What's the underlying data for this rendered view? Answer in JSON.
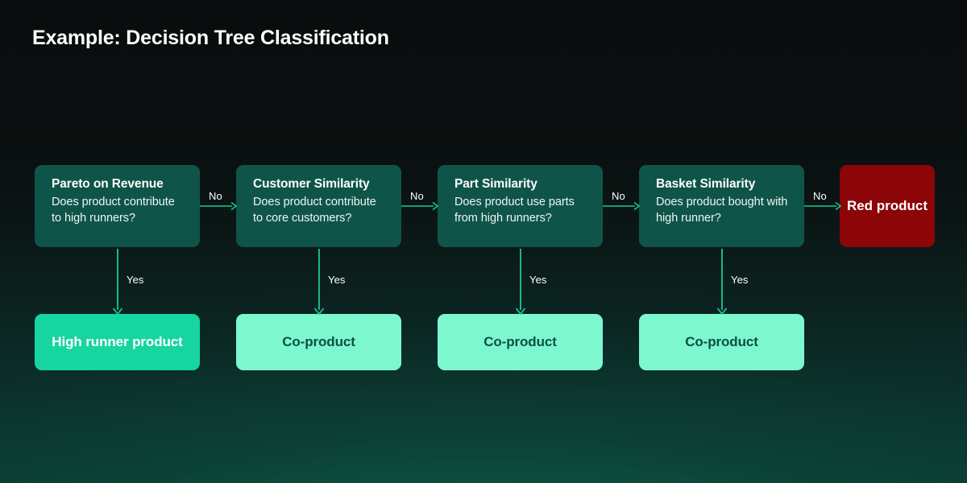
{
  "header": {
    "title": "Example: Decision Tree Classification"
  },
  "colors": {
    "background_top": "#0a0d0d",
    "background_bottom": "#0a3a32",
    "decision_box": "#0f5449",
    "high_runner_box": "#17d5a0",
    "co_product_box": "#7df7ce",
    "red_product_box": "#8c0508",
    "arrow": "#19c79a",
    "label_text": "#ffffff",
    "co_product_text": "#0d4f45"
  },
  "diagram": {
    "decision_nodes": [
      {
        "title": "Pareto on Revenue",
        "question": "Does product contribute to high runners?",
        "no_label": "No",
        "yes_label": "Yes"
      },
      {
        "title": "Customer Similarity",
        "question": "Does product contribute to core customers?",
        "no_label": "No",
        "yes_label": "Yes"
      },
      {
        "title": "Part Similarity",
        "question": "Does product use parts from high runners?",
        "no_label": "No",
        "yes_label": "Yes"
      },
      {
        "title": "Basket Similarity",
        "question": "Does product bought with high runner?",
        "no_label": "No",
        "yes_label": "Yes"
      }
    ],
    "outcome_nodes": [
      {
        "label": "High runner product",
        "kind": "high-runner"
      },
      {
        "label": "Co-product",
        "kind": "co-product"
      },
      {
        "label": "Co-product",
        "kind": "co-product"
      },
      {
        "label": "Co-product",
        "kind": "co-product"
      }
    ],
    "final_node": {
      "label": "Red product"
    }
  }
}
